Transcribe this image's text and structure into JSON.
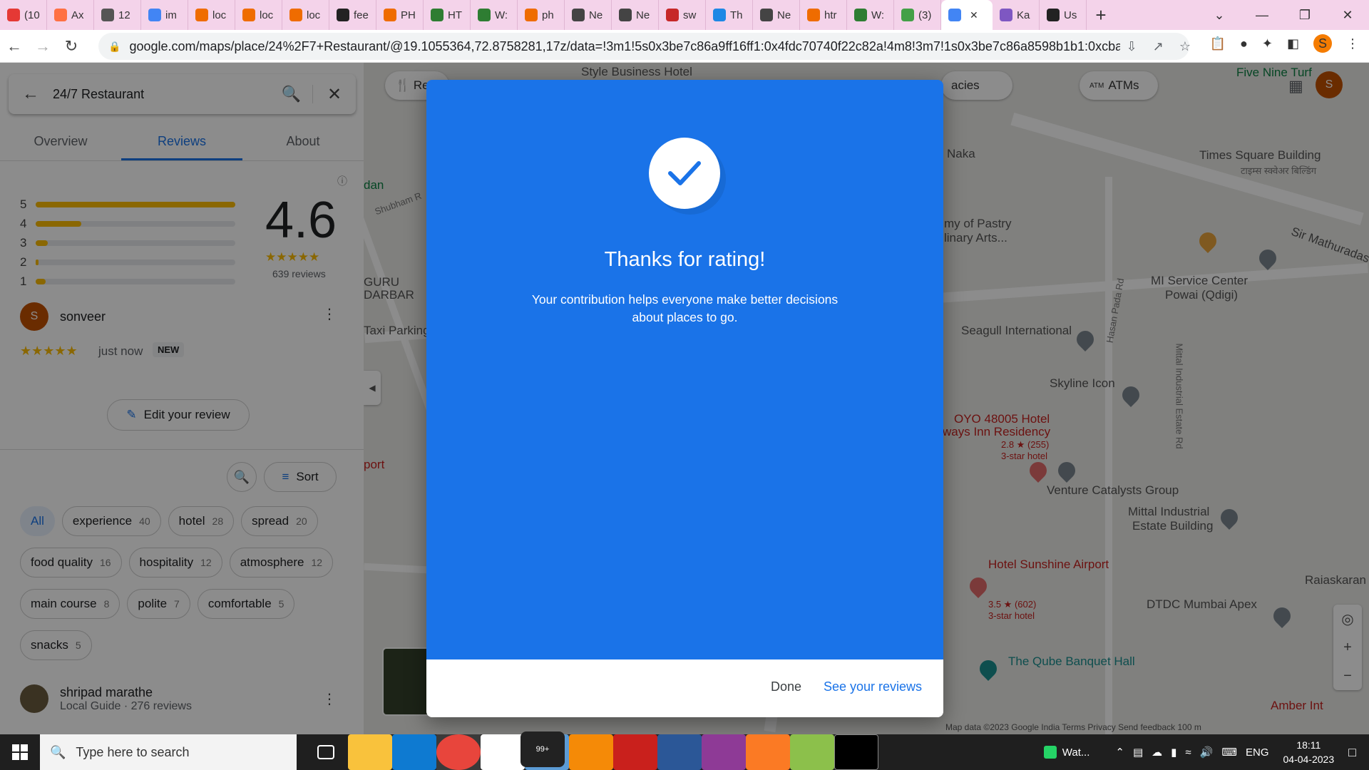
{
  "browser": {
    "tabs": [
      {
        "label": "(10",
        "color": "#e53935"
      },
      {
        "label": "Ax",
        "color": "#ff7043"
      },
      {
        "label": "12",
        "color": "#555"
      },
      {
        "label": "im",
        "color": "#4285f4"
      },
      {
        "label": "loc",
        "color": "#ef6c00"
      },
      {
        "label": "loc",
        "color": "#ef6c00"
      },
      {
        "label": "loc",
        "color": "#ef6c00"
      },
      {
        "label": "fee",
        "color": "#222"
      },
      {
        "label": "PH",
        "color": "#ef6c00"
      },
      {
        "label": "HT",
        "color": "#2e7d32"
      },
      {
        "label": "W:",
        "color": "#2e7d32"
      },
      {
        "label": "ph",
        "color": "#ef6c00"
      },
      {
        "label": "Ne",
        "color": "#444"
      },
      {
        "label": "Ne",
        "color": "#444"
      },
      {
        "label": "sw",
        "color": "#c62828"
      },
      {
        "label": "Th",
        "color": "#1e88e5"
      },
      {
        "label": "Ne",
        "color": "#444"
      },
      {
        "label": "htr",
        "color": "#ef6c00"
      },
      {
        "label": "W:",
        "color": "#2e7d32"
      },
      {
        "label": "(3)",
        "color": "#43a047"
      }
    ],
    "active_tab": {
      "label": "✕",
      "color": "#4285f4"
    },
    "after_tabs": [
      {
        "label": "Ka",
        "color": "#7e57c2"
      },
      {
        "label": "Us",
        "color": "#222"
      }
    ],
    "new_tab": "+",
    "url": "google.com/maps/place/24%2F7+Restaurant/@19.1055364,72.8758281,17z/data=!3m1!5s0x3be7c86a9ff16ff1:0x4fdc70740f22c82a!4m8!3m7!1s0x3be7c86a8598b1b1:0xcba65...",
    "profile_initial": "S"
  },
  "panel": {
    "search_query": "24/7 Restaurant",
    "tabs": [
      "Overview",
      "Reviews",
      "About"
    ],
    "histogram": [
      {
        "star": "5",
        "fraction": 1.0
      },
      {
        "star": "4",
        "fraction": 0.23
      },
      {
        "star": "3",
        "fraction": 0.06
      },
      {
        "star": "2",
        "fraction": 0.01
      },
      {
        "star": "1",
        "fraction": 0.05
      }
    ],
    "rating": "4.6",
    "rating_stars": "★★★★★",
    "review_count": "639 reviews",
    "user": {
      "initial": "S",
      "name": "sonveer",
      "stars": "★★★★★",
      "time": "just now",
      "badge": "NEW"
    },
    "edit_label": "Edit your review",
    "sort_label": "Sort",
    "chips": [
      {
        "label": "All",
        "count": ""
      },
      {
        "label": "experience",
        "count": "40"
      },
      {
        "label": "hotel",
        "count": "28"
      },
      {
        "label": "spread",
        "count": "20"
      },
      {
        "label": "food quality",
        "count": "16"
      },
      {
        "label": "hospitality",
        "count": "12"
      },
      {
        "label": "atmosphere",
        "count": "12"
      },
      {
        "label": "main course",
        "count": "8"
      },
      {
        "label": "polite",
        "count": "7"
      },
      {
        "label": "comfortable",
        "count": "5"
      },
      {
        "label": "snacks",
        "count": "5"
      }
    ],
    "reviewer2": {
      "name": "shripad marathe",
      "sub": "Local Guide · 276 reviews"
    }
  },
  "map": {
    "labels": {
      "style_business": "Style Business Hotel",
      "five_nine": "Five Nine Turf",
      "times_square": "Times Square Building",
      "times_square_hi": "टाइम्स स्क्वेअर बिल्डिंग",
      "mi_service": "MI Service Center",
      "mi_service2": "Powai (Qdigi)",
      "seagull": "Seagull International",
      "skyline": "Skyline Icon",
      "oyo": "OYO 48005 Hotel",
      "oyo2": "ways Inn Residency",
      "oyo_rating": "2.8 ★ (255)",
      "oyo_type": "3-star hotel",
      "venture": "Venture Catalysts Group",
      "mittal": "Mittal Industrial",
      "mittal2": "Estate Building",
      "sunshine": "Hotel Sunshine Airport",
      "sunshine_rating": "3.5 ★ (602)",
      "sunshine_type": "3-star hotel",
      "dtdc": "DTDC Mumbai Apex",
      "qube": "The Qube Banquet Hall",
      "raiaskaran": "Raiaskaran",
      "sir_mathuradas": "Sir Mathuradas",
      "hasan_pada": "Hasan Pada Rd",
      "mittal_rd": "Mittal Industrial Estate Rd",
      "naka": "Naka",
      "pastry": "my of Pastry",
      "pastry2": "linary Arts...",
      "guru": "GURU",
      "darbar": "DARBAR",
      "taxi": "Taxi Parking",
      "shubham": "Shubham R",
      "port": "port",
      "amber": "Amber Int",
      "atms": "ATMs",
      "pharmacies": "acies",
      "restaurants": "Re",
      "dan": "dan"
    },
    "footer": "Map data ©2023 Google   India   Terms   Privacy   Send feedback   100 m"
  },
  "dialog": {
    "title": "Thanks for rating!",
    "body": "Your contribution helps everyone make better decisions about places to go.",
    "done": "Done",
    "see_reviews": "See your reviews"
  },
  "taskbar": {
    "search_placeholder": "Type here to search",
    "whatsapp": "Wat...",
    "lang": "ENG",
    "time": "18:11",
    "date": "04-04-2023",
    "mail_badge": "99+"
  }
}
